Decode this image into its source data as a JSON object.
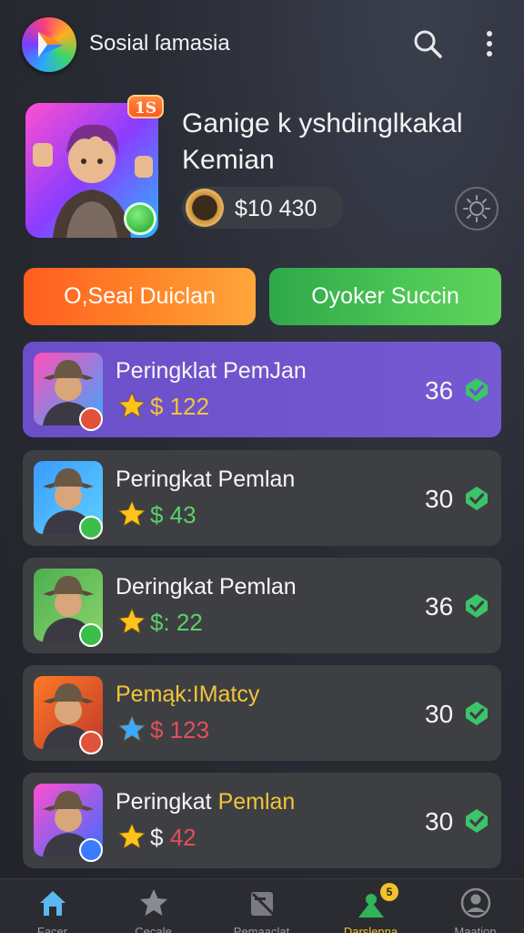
{
  "header": {
    "app_title": "Sosial ſamasia",
    "logo_icon": "play-logo-icon",
    "search_icon": "search-icon",
    "menu_icon": "kebab-menu-icon"
  },
  "profile": {
    "level_badge": "1S",
    "name": "Ganige k yshdinglkakal Kemian",
    "coins": "$10 430",
    "settings_icon": "gear-icon"
  },
  "actions": {
    "left_button": "O,Seai Duiclan",
    "right_button": "Oyoker Succin"
  },
  "leaderboard": [
    {
      "name": "Peringklat PemJan",
      "score": "$ 122",
      "score_color": "#f5c43a",
      "points": "36",
      "star_color": "#ffc21a"
    },
    {
      "name": "Peringkat Pemlan",
      "score": "$ 43",
      "score_color": "#5ccf6a",
      "points": "30",
      "star_color": "#ffc21a"
    },
    {
      "name": "Deringkat Pemlan",
      "score": "$: 22",
      "score_color": "#5ccf6a",
      "points": "36",
      "star_color": "#ffc21a"
    },
    {
      "name": "Pemąk:IMatcy",
      "score": "$ 123",
      "score_color": "#e0505a",
      "points": "30",
      "star_color": "#3aa8ff"
    },
    {
      "name_prefix": "Peringkat ",
      "name_suffix": "Pemlan",
      "score_prefix": "$ ",
      "score_value": "42",
      "score_color": "#e0505a",
      "points": "30",
      "star_color": "#ffc21a"
    }
  ],
  "nav": [
    {
      "label": "Facer",
      "icon": "home-icon"
    },
    {
      "label": "Cecale",
      "icon": "star-icon"
    },
    {
      "label": "Pemaaclat",
      "icon": "ranking-icon"
    },
    {
      "label": "Darslenna",
      "icon": "profile-upgrade-icon",
      "badge": "5"
    },
    {
      "label": "Maation",
      "icon": "account-icon"
    }
  ],
  "colors": {
    "accent_orange": "#ff7a26",
    "accent_green": "#4cc655",
    "active_card": "#6e53cc",
    "card": "#3e3f43",
    "nav_active": "#f2c22a"
  }
}
